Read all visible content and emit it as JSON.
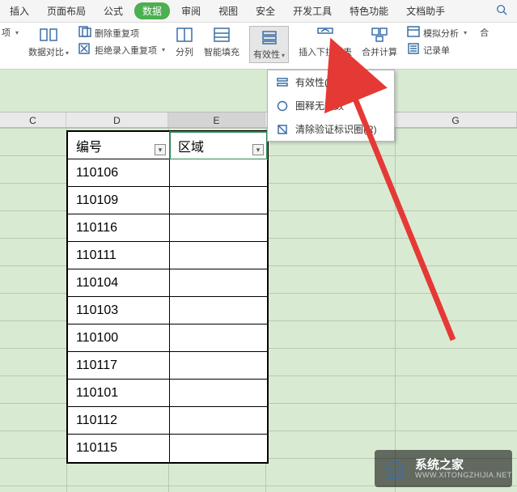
{
  "tabs": {
    "items": [
      "插入",
      "页面布局",
      "公式",
      "数据",
      "审阅",
      "视图",
      "安全",
      "开发工具",
      "特色功能",
      "文档助手"
    ],
    "active_index": 3
  },
  "ribbon": {
    "left_dd": "项",
    "data_compare": "数据对比",
    "del_dup_top": "删除重复项",
    "reject_dup": "拒绝录入重复项",
    "split_cols": "分列",
    "smart_fill": "智能填充",
    "validity": "有效性",
    "insert_dd": "插入下拉列表",
    "merge_calc": "合并计算",
    "record_form": "记录单",
    "sim_analysis": "模拟分析",
    "right_cut": "合"
  },
  "menu": {
    "item1": "有效性(V)",
    "item2": "圈释无效数",
    "item3": "清除验证标识圈(R)"
  },
  "columns": {
    "labels": [
      "C",
      "D",
      "E",
      "G"
    ]
  },
  "table": {
    "headers": {
      "h1": "编号",
      "h2": "区域"
    },
    "rows": [
      {
        "code": "110106",
        "region": ""
      },
      {
        "code": "110109",
        "region": ""
      },
      {
        "code": "110116",
        "region": ""
      },
      {
        "code": "110111",
        "region": ""
      },
      {
        "code": "110104",
        "region": ""
      },
      {
        "code": "110103",
        "region": ""
      },
      {
        "code": "110100",
        "region": ""
      },
      {
        "code": "110117",
        "region": ""
      },
      {
        "code": "110101",
        "region": ""
      },
      {
        "code": "110112",
        "region": ""
      },
      {
        "code": "110115",
        "region": ""
      }
    ]
  },
  "watermark": {
    "line1": "系统之家",
    "line2": "WWW.XITONGZHIJIA.NET"
  }
}
